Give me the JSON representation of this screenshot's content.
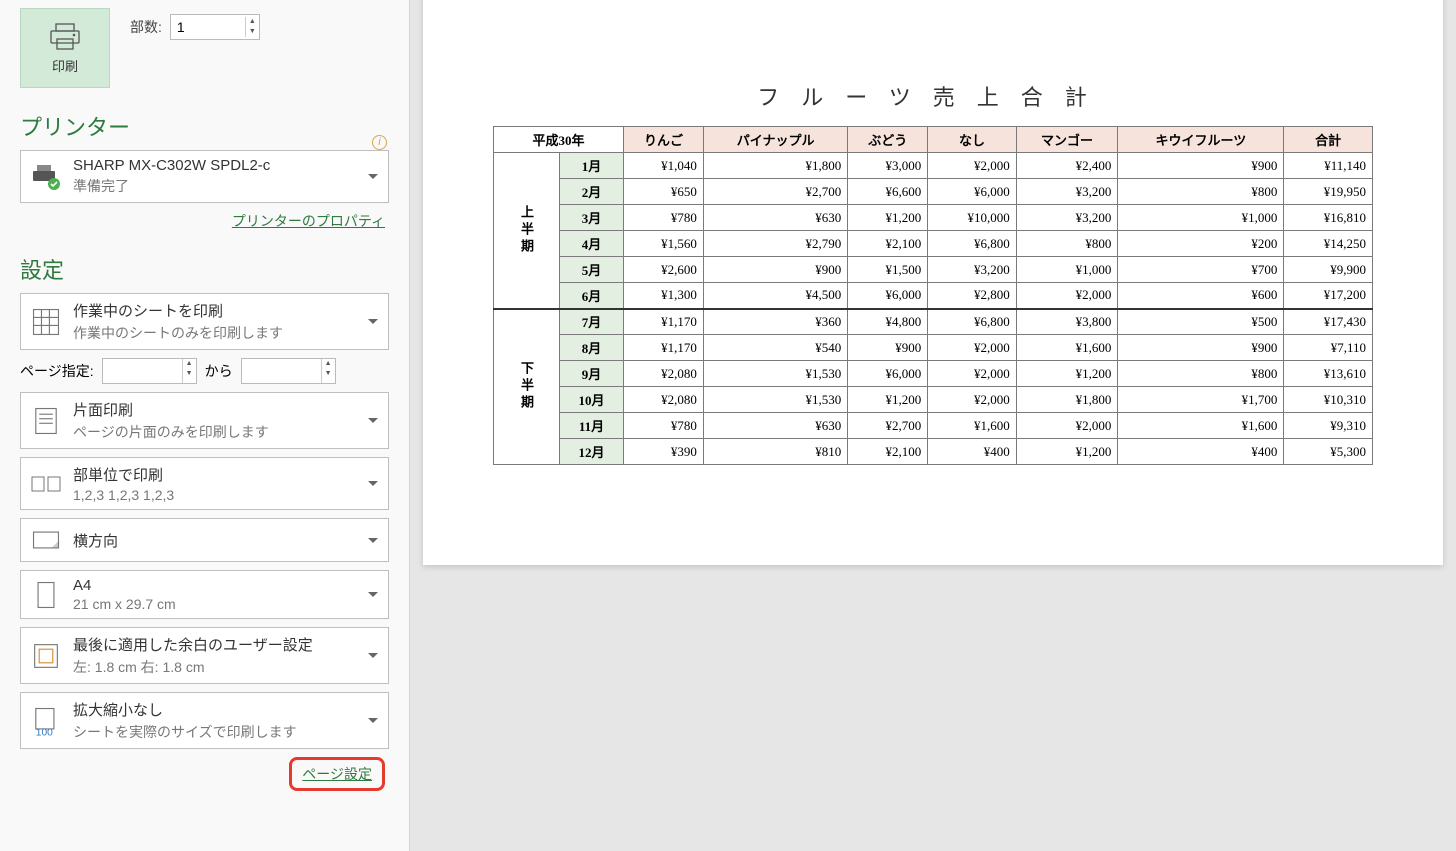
{
  "print_button_label": "印刷",
  "copies_label": "部数:",
  "copies_value": "1",
  "printer_heading": "プリンター",
  "printer_name": "SHARP MX-C302W SPDL2-c",
  "printer_status": "準備完了",
  "printer_props_link": "プリンターのプロパティ",
  "settings_heading": "設定",
  "print_what_l1": "作業中のシートを印刷",
  "print_what_l2": "作業中のシートのみを印刷します",
  "range_label": "ページ指定:",
  "range_to": "から",
  "duplex_l1": "片面印刷",
  "duplex_l2": "ページの片面のみを印刷します",
  "collate_l1": "部単位で印刷",
  "collate_l2": "1,2,3   1,2,3   1,2,3",
  "orient_l1": "横方向",
  "paper_l1": "A4",
  "paper_l2": "21 cm x 29.7 cm",
  "margins_l1": "最後に適用した余白のユーザー設定",
  "margins_l2": "左: 1.8 cm   右: 1.8 cm",
  "scale_l1": "拡大縮小なし",
  "scale_l2": "シートを実際のサイズで印刷します",
  "page_setup_link": "ページ設定",
  "preview": {
    "title": "フルーツ売上合計",
    "year_header": "平成30年",
    "fruit_headers": [
      "りんご",
      "パイナップル",
      "ぶどう",
      "なし",
      "マンゴー",
      "キウイフルーツ"
    ],
    "total_header": "合計",
    "period1": "上半期",
    "period2": "下半期",
    "rows1": [
      {
        "m": "1月",
        "v": [
          "¥1,040",
          "¥1,800",
          "¥3,000",
          "¥2,000",
          "¥2,400",
          "¥900"
        ],
        "t": "¥11,140"
      },
      {
        "m": "2月",
        "v": [
          "¥650",
          "¥2,700",
          "¥6,600",
          "¥6,000",
          "¥3,200",
          "¥800"
        ],
        "t": "¥19,950"
      },
      {
        "m": "3月",
        "v": [
          "¥780",
          "¥630",
          "¥1,200",
          "¥10,000",
          "¥3,200",
          "¥1,000"
        ],
        "t": "¥16,810"
      },
      {
        "m": "4月",
        "v": [
          "¥1,560",
          "¥2,790",
          "¥2,100",
          "¥6,800",
          "¥800",
          "¥200"
        ],
        "t": "¥14,250"
      },
      {
        "m": "5月",
        "v": [
          "¥2,600",
          "¥900",
          "¥1,500",
          "¥3,200",
          "¥1,000",
          "¥700"
        ],
        "t": "¥9,900"
      },
      {
        "m": "6月",
        "v": [
          "¥1,300",
          "¥4,500",
          "¥6,000",
          "¥2,800",
          "¥2,000",
          "¥600"
        ],
        "t": "¥17,200"
      }
    ],
    "rows2": [
      {
        "m": "7月",
        "v": [
          "¥1,170",
          "¥360",
          "¥4,800",
          "¥6,800",
          "¥3,800",
          "¥500"
        ],
        "t": "¥17,430"
      },
      {
        "m": "8月",
        "v": [
          "¥1,170",
          "¥540",
          "¥900",
          "¥2,000",
          "¥1,600",
          "¥900"
        ],
        "t": "¥7,110"
      },
      {
        "m": "9月",
        "v": [
          "¥2,080",
          "¥1,530",
          "¥6,000",
          "¥2,000",
          "¥1,200",
          "¥800"
        ],
        "t": "¥13,610"
      },
      {
        "m": "10月",
        "v": [
          "¥2,080",
          "¥1,530",
          "¥1,200",
          "¥2,000",
          "¥1,800",
          "¥1,700"
        ],
        "t": "¥10,310"
      },
      {
        "m": "11月",
        "v": [
          "¥780",
          "¥630",
          "¥2,700",
          "¥1,600",
          "¥2,000",
          "¥1,600"
        ],
        "t": "¥9,310"
      },
      {
        "m": "12月",
        "v": [
          "¥390",
          "¥810",
          "¥2,100",
          "¥400",
          "¥1,200",
          "¥400"
        ],
        "t": "¥5,300"
      }
    ]
  }
}
